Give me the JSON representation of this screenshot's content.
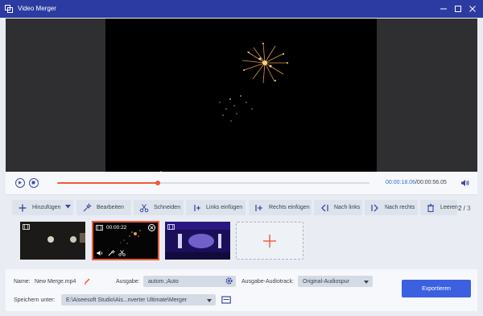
{
  "window": {
    "title": "Video Merger",
    "accent": "#2b3ba1"
  },
  "player": {
    "current_time": "00:00:18.06",
    "total_time": "/00:00:56.05",
    "progress_fraction": 0.322
  },
  "toolbar": {
    "add_label": "Hinzufügen",
    "edit_label": "Bearbeiten",
    "cut_label": "Schneiden",
    "insert_left_label": "Links einfügen",
    "insert_right_label": "Rechts einfügen",
    "move_left_label": "Nach links",
    "move_right_label": "Nach rechts",
    "clear_label": "Leeren",
    "page_current": "2",
    "page_total": "3"
  },
  "clips": [
    {
      "duration": "",
      "selected": false
    },
    {
      "duration": "00:00:22",
      "selected": true
    },
    {
      "duration": "",
      "selected": false
    }
  ],
  "output": {
    "name_label": "Name:",
    "name_value": "New Merge.mp4",
    "format_label": "Ausgabe:",
    "format_value": "autom.;Auto",
    "audio_label": "Ausgabe-Audiotrack:",
    "audio_value": "Original-Audiospur",
    "save_label": "Speichern unter:",
    "save_path": "E:\\Aiseesoft Studio\\Ais...nverter Ultimate\\Merger",
    "export_label": "Exportieren"
  },
  "colors": {
    "progress": "#ef5b3a",
    "export": "#3b60e0",
    "time_current": "#2f6fd0"
  }
}
